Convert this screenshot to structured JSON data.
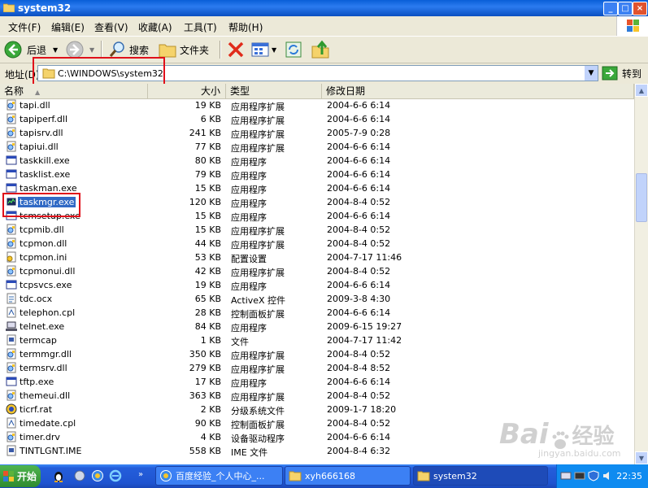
{
  "window": {
    "title": "system32",
    "buttons": {
      "minimize": "_",
      "maximize": "□",
      "close": "×"
    }
  },
  "menu": [
    "文件(F)",
    "编辑(E)",
    "查看(V)",
    "收藏(A)",
    "工具(T)",
    "帮助(H)"
  ],
  "toolbar": {
    "back": "后退",
    "search": "搜索",
    "folders": "文件夹"
  },
  "address": {
    "label": "地址(D)",
    "value": "C:\\WINDOWS\\system32",
    "go": "转到"
  },
  "columns": {
    "name": "名称",
    "size": "大小",
    "type": "类型",
    "modified": "修改日期"
  },
  "files": [
    {
      "name": "tapi.dll",
      "size": "19 KB",
      "type": "应用程序扩展",
      "date": "2004-6-6 6:14",
      "icon": "dll"
    },
    {
      "name": "tapiperf.dll",
      "size": "6 KB",
      "type": "应用程序扩展",
      "date": "2004-6-6 6:14",
      "icon": "dll"
    },
    {
      "name": "tapisrv.dll",
      "size": "241 KB",
      "type": "应用程序扩展",
      "date": "2005-7-9 0:28",
      "icon": "dll"
    },
    {
      "name": "tapiui.dll",
      "size": "77 KB",
      "type": "应用程序扩展",
      "date": "2004-6-6 6:14",
      "icon": "dll"
    },
    {
      "name": "taskkill.exe",
      "size": "80 KB",
      "type": "应用程序",
      "date": "2004-6-6 6:14",
      "icon": "exe"
    },
    {
      "name": "tasklist.exe",
      "size": "79 KB",
      "type": "应用程序",
      "date": "2004-6-6 6:14",
      "icon": "exe"
    },
    {
      "name": "taskman.exe",
      "size": "15 KB",
      "type": "应用程序",
      "date": "2004-6-6 6:14",
      "icon": "exe"
    },
    {
      "name": "taskmgr.exe",
      "size": "120 KB",
      "type": "应用程序",
      "date": "2004-8-4 0:52",
      "icon": "taskmgr"
    },
    {
      "name": "tcmsetup.exe",
      "size": "15 KB",
      "type": "应用程序",
      "date": "2004-6-6 6:14",
      "icon": "exe"
    },
    {
      "name": "tcpmib.dll",
      "size": "15 KB",
      "type": "应用程序扩展",
      "date": "2004-8-4 0:52",
      "icon": "dll"
    },
    {
      "name": "tcpmon.dll",
      "size": "44 KB",
      "type": "应用程序扩展",
      "date": "2004-8-4 0:52",
      "icon": "dll"
    },
    {
      "name": "tcpmon.ini",
      "size": "53 KB",
      "type": "配置设置",
      "date": "2004-7-17 11:46",
      "icon": "ini"
    },
    {
      "name": "tcpmonui.dll",
      "size": "42 KB",
      "type": "应用程序扩展",
      "date": "2004-8-4 0:52",
      "icon": "dll"
    },
    {
      "name": "tcpsvcs.exe",
      "size": "19 KB",
      "type": "应用程序",
      "date": "2004-6-6 6:14",
      "icon": "exe"
    },
    {
      "name": "tdc.ocx",
      "size": "65 KB",
      "type": "ActiveX 控件",
      "date": "2009-3-8 4:30",
      "icon": "ocx"
    },
    {
      "name": "telephon.cpl",
      "size": "28 KB",
      "type": "控制面板扩展",
      "date": "2004-6-6 6:14",
      "icon": "cpl"
    },
    {
      "name": "telnet.exe",
      "size": "84 KB",
      "type": "应用程序",
      "date": "2009-6-15 19:27",
      "icon": "telnet"
    },
    {
      "name": "termcap",
      "size": "1 KB",
      "type": "文件",
      "date": "2004-7-17 11:42",
      "icon": "file"
    },
    {
      "name": "termmgr.dll",
      "size": "350 KB",
      "type": "应用程序扩展",
      "date": "2004-8-4 0:52",
      "icon": "dll"
    },
    {
      "name": "termsrv.dll",
      "size": "279 KB",
      "type": "应用程序扩展",
      "date": "2004-8-4 8:52",
      "icon": "dll"
    },
    {
      "name": "tftp.exe",
      "size": "17 KB",
      "type": "应用程序",
      "date": "2004-6-6 6:14",
      "icon": "exe"
    },
    {
      "name": "themeui.dll",
      "size": "363 KB",
      "type": "应用程序扩展",
      "date": "2004-8-4 0:52",
      "icon": "dll"
    },
    {
      "name": "ticrf.rat",
      "size": "2 KB",
      "type": "分级系统文件",
      "date": "2009-1-7 18:20",
      "icon": "rat"
    },
    {
      "name": "timedate.cpl",
      "size": "90 KB",
      "type": "控制面板扩展",
      "date": "2004-8-4 0:52",
      "icon": "cpl"
    },
    {
      "name": "timer.drv",
      "size": "4 KB",
      "type": "设备驱动程序",
      "date": "2004-6-6 6:14",
      "icon": "dll"
    },
    {
      "name": "TINTLGNT.IME",
      "size": "558 KB",
      "type": "IME 文件",
      "date": "2004-8-4 6:32",
      "icon": "file"
    }
  ],
  "selected_file": "taskmgr.exe",
  "taskbar": {
    "start": "开始",
    "items": [
      {
        "label": "百度经验_个人中心_..."
      },
      {
        "label": "xyh666168"
      },
      {
        "label": "system32"
      }
    ],
    "clock": "22:35"
  },
  "watermark": {
    "brand": "Bai",
    "brand2": "经验",
    "url": "jingyan.baidu.com"
  },
  "colors": {
    "highlight_box": "#e0101a",
    "selection": "#316ac5",
    "titlebar": "#0a5fd8"
  }
}
